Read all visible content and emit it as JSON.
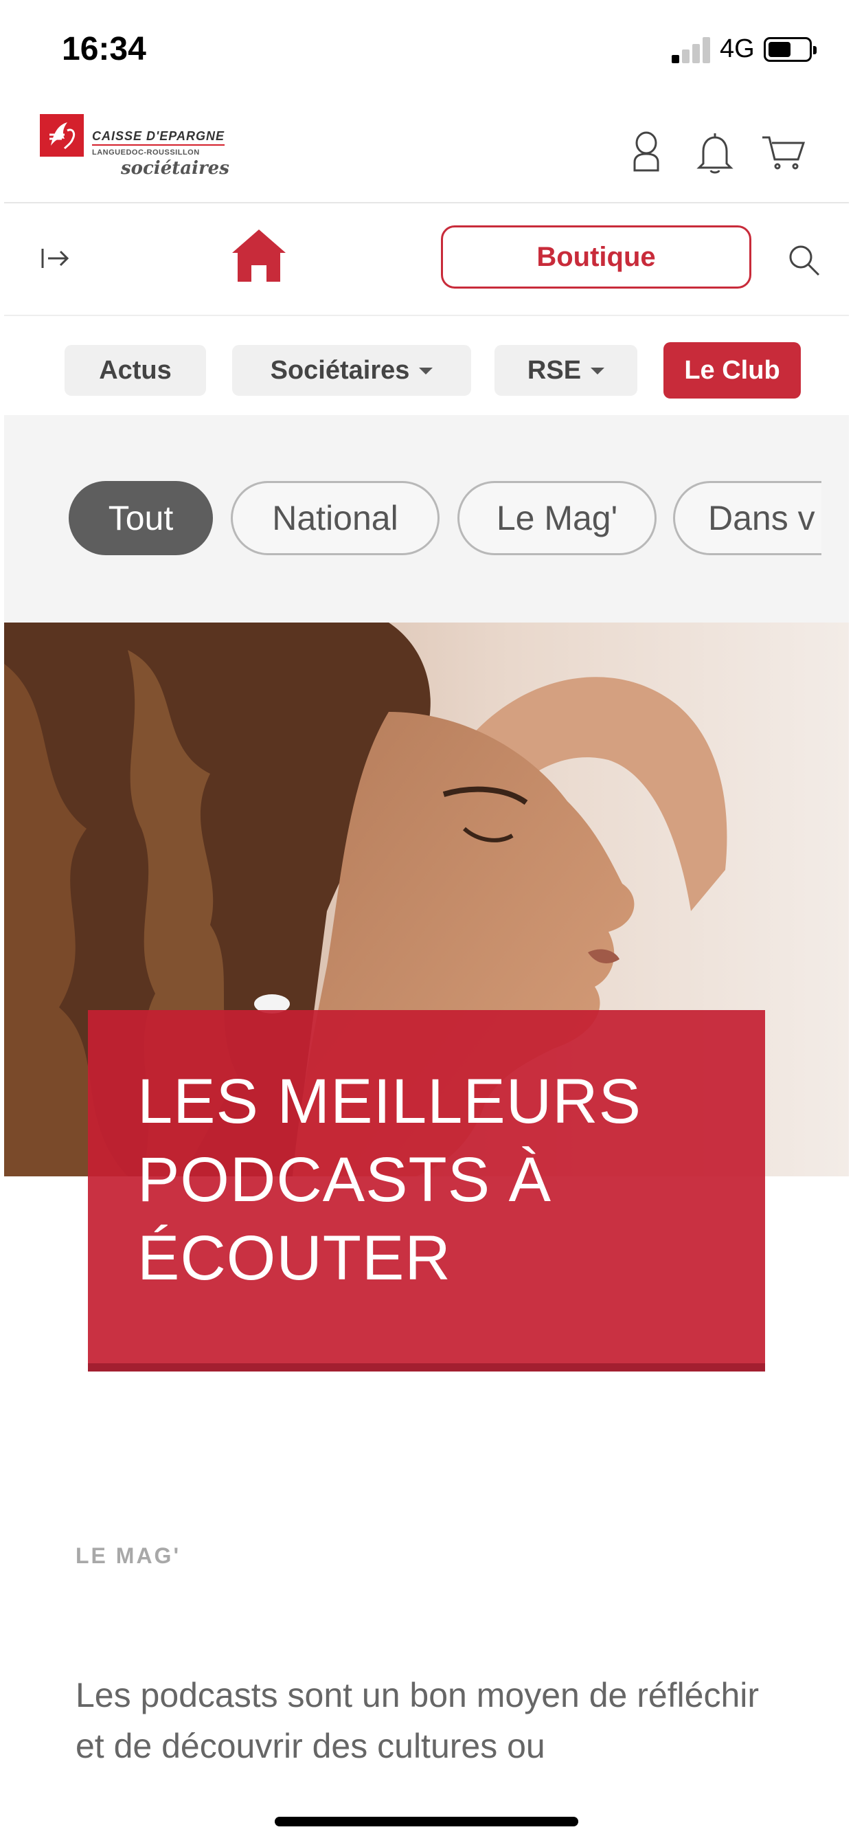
{
  "status_bar": {
    "time": "16:34",
    "network": "4G",
    "signal_bars_active": 1,
    "battery_level": 0.55
  },
  "header": {
    "logo": {
      "line1": "CAISSE D'EPARGNE",
      "line2": "LANGUEDOC-ROUSSILLON",
      "line3": "sociétaires"
    },
    "icons": [
      "user-icon",
      "bell-icon",
      "cart-icon"
    ]
  },
  "nav": {
    "boutique_label": "Boutique",
    "icons": [
      "exit-icon",
      "home-icon",
      "search-icon"
    ]
  },
  "menu": {
    "items": [
      {
        "label": "Actus",
        "dropdown": false
      },
      {
        "label": "Sociétaires",
        "dropdown": true
      },
      {
        "label": "RSE",
        "dropdown": true
      },
      {
        "label": "Le Club",
        "dropdown": false,
        "highlighted": true
      }
    ]
  },
  "filters": {
    "chips": [
      {
        "label": "Tout",
        "active": true
      },
      {
        "label": "National",
        "active": false
      },
      {
        "label": "Le Mag'",
        "active": false
      },
      {
        "label": "Dans v",
        "active": false
      }
    ]
  },
  "article": {
    "title": "LES MEILLEURS PODCASTS À ÉCOUTER",
    "category": "LE MAG'",
    "excerpt": "Les podcasts sont un bon moyen de réfléchir et de découvrir des cultures ou"
  },
  "colors": {
    "brand_red": "#c82b3a",
    "logo_red": "#d4202c",
    "chip_active": "#5e5e5e",
    "band_bg": "#f4f4f4"
  }
}
